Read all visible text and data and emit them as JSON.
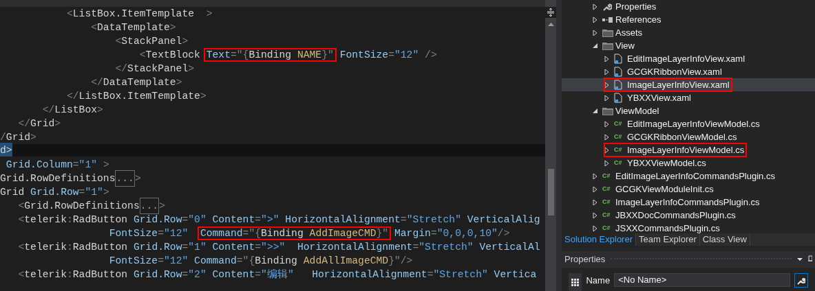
{
  "editor": {
    "top_lines": [
      {
        "tokens": [
          {
            "kind": "punct",
            "text": "           <"
          },
          {
            "kind": "element",
            "text": "ListBox.ItemTemplate"
          },
          {
            "kind": "punct",
            "text": "  >"
          }
        ]
      },
      {
        "tokens": [
          {
            "kind": "punct",
            "text": "               <"
          },
          {
            "kind": "element",
            "text": "DataTemplate"
          },
          {
            "kind": "punct",
            "text": ">"
          }
        ]
      },
      {
        "tokens": [
          {
            "kind": "punct",
            "text": "                   <"
          },
          {
            "kind": "element",
            "text": "StackPanel"
          },
          {
            "kind": "punct",
            "text": ">"
          }
        ]
      },
      {
        "tokens": [
          {
            "kind": "punct",
            "text": "                       <"
          },
          {
            "kind": "element",
            "text": "TextBlock "
          },
          {
            "kind": "box",
            "tokens": [
              {
                "kind": "attribute",
                "text": "Text"
              },
              {
                "kind": "punct",
                "text": "=\"{"
              },
              {
                "kind": "element",
                "text": "Binding "
              },
              {
                "kind": "binding",
                "text": "NAME"
              },
              {
                "kind": "punct",
                "text": "}\""
              }
            ]
          },
          {
            "kind": "attribute",
            "text": " FontSize"
          },
          {
            "kind": "punct",
            "text": "="
          },
          {
            "kind": "value",
            "text": "\"12\""
          },
          {
            "kind": "punct",
            "text": " />"
          }
        ]
      },
      {
        "tokens": [
          {
            "kind": "punct",
            "text": "                   </"
          },
          {
            "kind": "element",
            "text": "StackPanel"
          },
          {
            "kind": "punct",
            "text": ">"
          }
        ]
      },
      {
        "tokens": [
          {
            "kind": "punct",
            "text": "               </"
          },
          {
            "kind": "element",
            "text": "DataTemplate"
          },
          {
            "kind": "punct",
            "text": ">"
          }
        ]
      },
      {
        "tokens": [
          {
            "kind": "punct",
            "text": "           </"
          },
          {
            "kind": "element",
            "text": "ListBox.ItemTemplate"
          },
          {
            "kind": "punct",
            "text": ">"
          }
        ]
      },
      {
        "tokens": [
          {
            "kind": "punct",
            "text": "       </"
          },
          {
            "kind": "element",
            "text": "ListBox"
          },
          {
            "kind": "punct",
            "text": ">"
          }
        ]
      },
      {
        "tokens": [
          {
            "kind": "punct",
            "text": "   </"
          },
          {
            "kind": "element",
            "text": "Grid"
          },
          {
            "kind": "punct",
            "text": ">"
          }
        ]
      },
      {
        "tokens": [
          {
            "kind": "punct",
            "text": "/"
          },
          {
            "kind": "element",
            "text": "Grid"
          },
          {
            "kind": "punct",
            "text": ">"
          }
        ]
      }
    ],
    "current_line": {
      "text": "d>",
      "selected": true
    },
    "bottom_lines": [
      {
        "tokens": [
          {
            "kind": "attribute",
            "text": " Grid.Column"
          },
          {
            "kind": "punct",
            "text": "="
          },
          {
            "kind": "value",
            "text": "\"1\""
          },
          {
            "kind": "punct",
            "text": " >"
          }
        ]
      },
      {
        "tokens": [
          {
            "kind": "element",
            "text": "Grid.RowDefinitions"
          },
          {
            "kind": "collapsed",
            "text": "..."
          },
          {
            "kind": "punct",
            "text": ">"
          }
        ]
      },
      {
        "tokens": [
          {
            "kind": "element",
            "text": "Grid"
          },
          {
            "kind": "attribute",
            "text": " Grid.Row"
          },
          {
            "kind": "punct",
            "text": "="
          },
          {
            "kind": "value",
            "text": "\"1\""
          },
          {
            "kind": "punct",
            "text": ">"
          }
        ]
      },
      {
        "tokens": [
          {
            "kind": "punct",
            "text": "   <"
          },
          {
            "kind": "element",
            "text": "Grid.RowDefinitions"
          },
          {
            "kind": "collapsed",
            "text": "..."
          },
          {
            "kind": "punct",
            "text": ">"
          }
        ]
      },
      {
        "tokens": [
          {
            "kind": "punct",
            "text": "   <"
          },
          {
            "kind": "element",
            "text": "telerik"
          },
          {
            "kind": "punct",
            "text": ":"
          },
          {
            "kind": "element",
            "text": "RadButton"
          },
          {
            "kind": "attribute",
            "text": " Grid.Row"
          },
          {
            "kind": "punct",
            "text": "="
          },
          {
            "kind": "value",
            "text": "\"0\""
          },
          {
            "kind": "attribute",
            "text": " Content"
          },
          {
            "kind": "punct",
            "text": "="
          },
          {
            "kind": "value",
            "text": "\">\""
          },
          {
            "kind": "attribute",
            "text": " HorizontalAlignment"
          },
          {
            "kind": "punct",
            "text": "="
          },
          {
            "kind": "value",
            "text": "\"Stretch\""
          },
          {
            "kind": "attribute",
            "text": " VerticalAlig"
          }
        ]
      },
      {
        "tokens": [
          {
            "kind": "attribute",
            "text": "                  FontSize"
          },
          {
            "kind": "punct",
            "text": "="
          },
          {
            "kind": "value",
            "text": "\"12\"  "
          },
          {
            "kind": "box",
            "tokens": [
              {
                "kind": "attribute",
                "text": "Command"
              },
              {
                "kind": "punct",
                "text": "=\"{"
              },
              {
                "kind": "element",
                "text": "Binding "
              },
              {
                "kind": "binding",
                "text": "AddImageCMD"
              },
              {
                "kind": "punct",
                "text": "}\""
              }
            ]
          },
          {
            "kind": "attribute",
            "text": " Margin"
          },
          {
            "kind": "punct",
            "text": "="
          },
          {
            "kind": "value",
            "text": "\"0,0,0,10\""
          },
          {
            "kind": "punct",
            "text": "/>"
          }
        ]
      },
      {
        "tokens": [
          {
            "kind": "punct",
            "text": "   <"
          },
          {
            "kind": "element",
            "text": "telerik"
          },
          {
            "kind": "punct",
            "text": ":"
          },
          {
            "kind": "element",
            "text": "RadButton"
          },
          {
            "kind": "attribute",
            "text": " Grid.Row"
          },
          {
            "kind": "punct",
            "text": "="
          },
          {
            "kind": "value",
            "text": "\"1\""
          },
          {
            "kind": "attribute",
            "text": " Content"
          },
          {
            "kind": "punct",
            "text": "="
          },
          {
            "kind": "value",
            "text": "\">>\""
          },
          {
            "kind": "attribute",
            "text": "  HorizontalAlignment"
          },
          {
            "kind": "punct",
            "text": "="
          },
          {
            "kind": "value",
            "text": "\"Stretch\""
          },
          {
            "kind": "attribute",
            "text": " VerticalAl"
          }
        ]
      },
      {
        "tokens": [
          {
            "kind": "attribute",
            "text": "                  FontSize"
          },
          {
            "kind": "punct",
            "text": "="
          },
          {
            "kind": "value",
            "text": "\"12\""
          },
          {
            "kind": "attribute",
            "text": " Command"
          },
          {
            "kind": "punct",
            "text": "=\"{"
          },
          {
            "kind": "element",
            "text": "Binding "
          },
          {
            "kind": "binding",
            "text": "AddAllImageCMD"
          },
          {
            "kind": "punct",
            "text": "}\"/>"
          }
        ]
      },
      {
        "tokens": [
          {
            "kind": "punct",
            "text": "   <"
          },
          {
            "kind": "element",
            "text": "telerik"
          },
          {
            "kind": "punct",
            "text": ":"
          },
          {
            "kind": "element",
            "text": "RadButton"
          },
          {
            "kind": "attribute",
            "text": " Grid.Row"
          },
          {
            "kind": "punct",
            "text": "="
          },
          {
            "kind": "value",
            "text": "\"2\""
          },
          {
            "kind": "attribute",
            "text": " Content"
          },
          {
            "kind": "punct",
            "text": "="
          },
          {
            "kind": "value",
            "text": "\"编辑\""
          },
          {
            "kind": "attribute",
            "text": "   HorizontalAlignment"
          },
          {
            "kind": "punct",
            "text": "="
          },
          {
            "kind": "value",
            "text": "\"Stretch\""
          },
          {
            "kind": "attribute",
            "text": " Vertica"
          }
        ]
      }
    ]
  },
  "solution_explorer": {
    "tree": [
      {
        "kind": "properties",
        "label": "Properties",
        "expanded": false,
        "selected": false,
        "boxed": false
      },
      {
        "kind": "references",
        "label": "References",
        "expanded": false,
        "selected": false,
        "boxed": false
      },
      {
        "kind": "folder",
        "label": "Assets",
        "expanded": false,
        "selected": false,
        "boxed": false
      },
      {
        "kind": "folder",
        "label": "View",
        "expanded": true,
        "selected": false,
        "boxed": false,
        "children": [
          {
            "kind": "xaml",
            "label": "EditImageLayerInfoView.xaml",
            "expanded": false,
            "selected": false,
            "boxed": false
          },
          {
            "kind": "xaml",
            "label": "GCGKRibbonView.xaml",
            "expanded": false,
            "selected": false,
            "boxed": false
          },
          {
            "kind": "xaml",
            "label": "ImageLayerInfoView.xaml",
            "expanded": false,
            "selected": true,
            "boxed": true
          },
          {
            "kind": "xaml",
            "label": "YBXXView.xaml",
            "expanded": false,
            "selected": false,
            "boxed": false
          }
        ]
      },
      {
        "kind": "folder",
        "label": "ViewModel",
        "expanded": true,
        "selected": false,
        "boxed": false,
        "children": [
          {
            "kind": "cs",
            "badge": "C#",
            "label": "EditImageLayerInfoViewModel.cs",
            "expanded": false,
            "selected": false,
            "boxed": false
          },
          {
            "kind": "cs",
            "badge": "C#",
            "label": "GCGKRibbonViewModel.cs",
            "expanded": false,
            "selected": false,
            "boxed": false
          },
          {
            "kind": "cs",
            "badge": "C#",
            "label": "ImageLayerInfoViewModel.cs",
            "expanded": false,
            "selected": false,
            "boxed": true
          },
          {
            "kind": "cs",
            "badge": "C#",
            "label": "YBXXViewModel.cs",
            "expanded": false,
            "selected": false,
            "boxed": false
          }
        ]
      },
      {
        "kind": "cs",
        "badge": "C#",
        "label": "EditImageLayerInfoCommandsPlugin.cs",
        "expanded": false,
        "selected": false,
        "boxed": false
      },
      {
        "kind": "cs",
        "badge": "C#",
        "label": "GCGKViewModuleInit.cs",
        "expanded": false,
        "selected": false,
        "boxed": false
      },
      {
        "kind": "cs",
        "badge": "C#",
        "label": "ImageLayerInfoCommandsPlugin.cs",
        "expanded": false,
        "selected": false,
        "boxed": false
      },
      {
        "kind": "cs",
        "badge": "C#",
        "label": "JBXXDocCommandsPlugin.cs",
        "expanded": false,
        "selected": false,
        "boxed": false
      },
      {
        "kind": "cs",
        "badge": "C#",
        "label": "JSXXCommandsPlugin.cs",
        "expanded": false,
        "selected": false,
        "boxed": false
      }
    ],
    "tabs": [
      {
        "label": "Solution Explorer",
        "selected": true
      },
      {
        "label": "Team Explorer",
        "selected": false
      },
      {
        "label": "Class View",
        "selected": false
      }
    ]
  },
  "properties": {
    "title": "Properties",
    "name_label": "Name",
    "name_value": "<No Name>"
  }
}
